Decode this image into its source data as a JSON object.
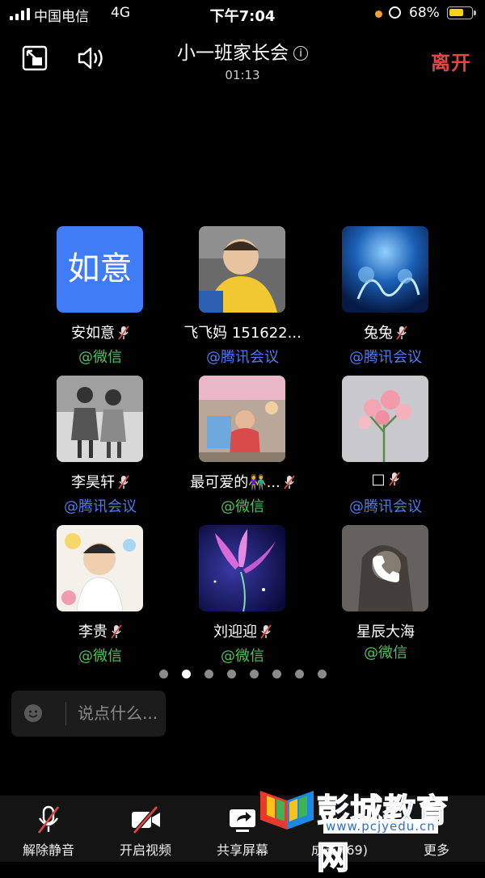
{
  "status_bar": {
    "carrier": "中国电信",
    "network": "4G",
    "time": "下午7:04",
    "battery_percent": "68%",
    "battery_level": 0.68
  },
  "header": {
    "title": "小一班家长会",
    "timer": "01:13",
    "leave_label": "离开",
    "info_glyph": "i"
  },
  "participants": [
    {
      "name": "安如意",
      "source": "@微信",
      "avatar_text": "如意",
      "muted": true
    },
    {
      "name": "飞飞妈 151622...",
      "source": "@腾讯会议",
      "muted": false
    },
    {
      "name": "兔兔",
      "source": "@腾讯会议",
      "muted": true
    },
    {
      "name": "李昊轩",
      "source": "@腾讯会议",
      "muted": true
    },
    {
      "name": "最可爱的👫...",
      "source": "@微信",
      "muted": true
    },
    {
      "name": "□",
      "source": "@腾讯会议",
      "muted": true
    },
    {
      "name": "李贵",
      "source": "@微信",
      "muted": true
    },
    {
      "name": "刘迎迎",
      "source": "@微信",
      "muted": true
    },
    {
      "name": "星辰大海",
      "source": "@微信",
      "muted": false,
      "calling": true
    }
  ],
  "pagination": {
    "total": 8,
    "current": 2
  },
  "chat": {
    "placeholder": "说点什么..."
  },
  "toolbar": {
    "unmute_label": "解除静音",
    "video_label": "开启视频",
    "share_label": "共享屏幕",
    "members_label": "成员 (69)",
    "more_label": "更多"
  },
  "watermark": {
    "name": "彭城教育网",
    "url": "www.pcjyedu.cn"
  },
  "colors": {
    "leave": "#e54545",
    "wechat": "#4fbf5f",
    "tencent": "#4a7cf0",
    "avatar_blue": "#3f7cf6"
  }
}
